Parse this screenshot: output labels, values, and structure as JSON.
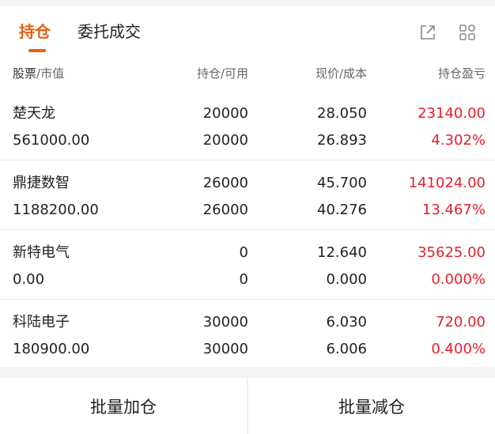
{
  "tabs": [
    {
      "label": "持仓",
      "active": true
    },
    {
      "label": "委托成交",
      "active": false
    }
  ],
  "icons": {
    "export": "export-icon",
    "grid": "grid-icon"
  },
  "colors": {
    "accent": "#e8600f",
    "profit": "#e8202c"
  },
  "header": {
    "col1_primary": "股票",
    "col1_secondary": "/市值",
    "col2": "持仓/可用",
    "col3": "现价/成本",
    "col4": "持仓盈亏"
  },
  "positions": [
    {
      "name": "楚天龙",
      "value": "561000.00",
      "holding": "20000",
      "available": "20000",
      "price": "28.050",
      "cost": "26.893",
      "pnl": "23140.00",
      "pnl_pct": "4.302%"
    },
    {
      "name": "鼎捷数智",
      "value": "1188200.00",
      "holding": "26000",
      "available": "26000",
      "price": "45.700",
      "cost": "40.276",
      "pnl": "141024.00",
      "pnl_pct": "13.467%"
    },
    {
      "name": "新特电气",
      "value": "0.00",
      "holding": "0",
      "available": "0",
      "price": "12.640",
      "cost": "0.000",
      "pnl": "35625.00",
      "pnl_pct": "0.000%"
    },
    {
      "name": "科陆电子",
      "value": "180900.00",
      "holding": "30000",
      "available": "30000",
      "price": "6.030",
      "cost": "6.006",
      "pnl": "720.00",
      "pnl_pct": "0.400%"
    }
  ],
  "buttons": {
    "batch_add": "批量加仓",
    "batch_reduce": "批量减仓"
  }
}
